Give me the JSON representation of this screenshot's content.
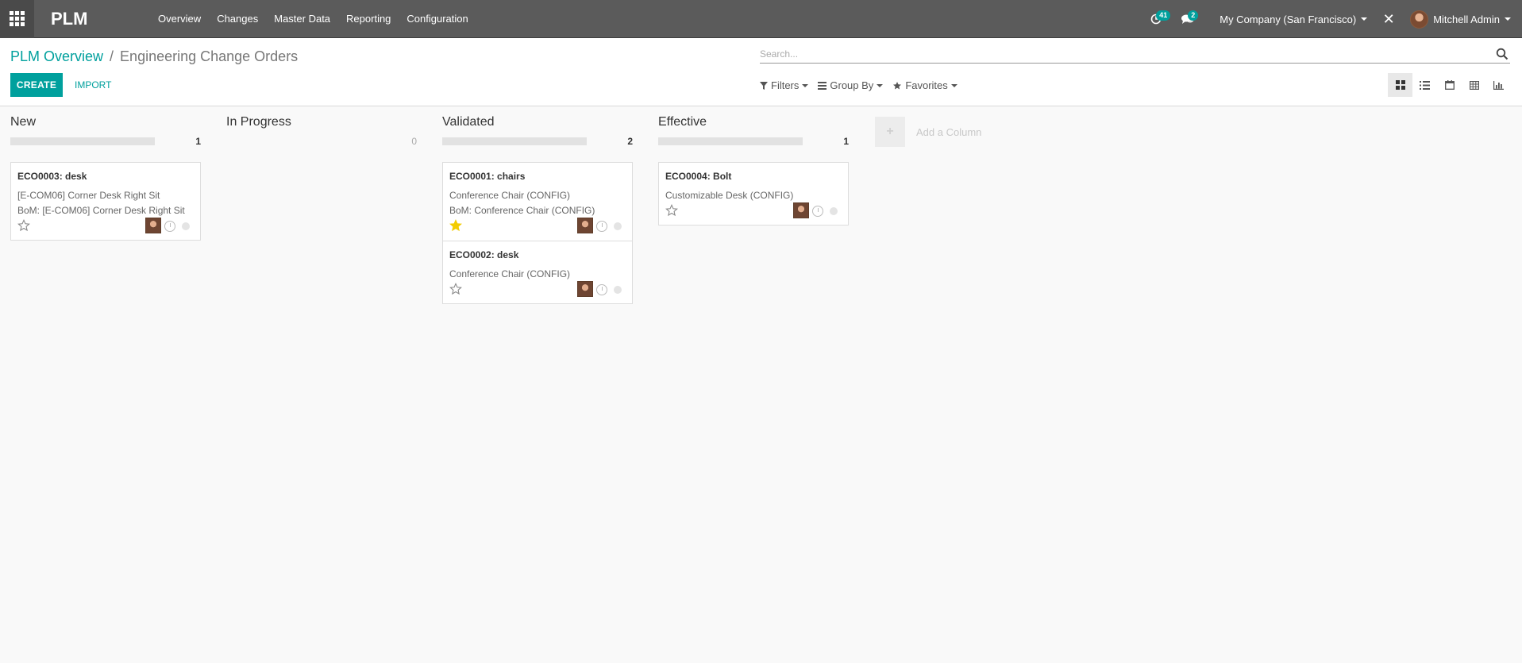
{
  "app": {
    "brand": "PLM"
  },
  "menu": [
    "Overview",
    "Changes",
    "Master Data",
    "Reporting",
    "Configuration"
  ],
  "systray": {
    "activity_count": "41",
    "messages_count": "2",
    "company": "My Company (San Francisco)",
    "user": "Mitchell Admin"
  },
  "breadcrumb": {
    "parent": "PLM Overview",
    "separator": "/",
    "current": "Engineering Change Orders"
  },
  "buttons": {
    "create": "CREATE",
    "import": "IMPORT"
  },
  "search": {
    "placeholder": "Search..."
  },
  "search_tools": {
    "filters": "Filters",
    "group_by": "Group By",
    "favorites": "Favorites"
  },
  "views": [
    "kanban-view",
    "list-view",
    "calendar-view",
    "pivot-view",
    "graph-view"
  ],
  "columns": [
    {
      "title": "New",
      "count": "1",
      "cards": [
        {
          "title": "ECO0003: desk",
          "lines": [
            "[E-COM06] Corner Desk Right Sit",
            "BoM: [E-COM06] Corner Desk Right Sit"
          ],
          "starred": false
        }
      ]
    },
    {
      "title": "In Progress",
      "count": "0",
      "cards": []
    },
    {
      "title": "Validated",
      "count": "2",
      "cards": [
        {
          "title": "ECO0001: chairs",
          "lines": [
            "Conference Chair (CONFIG)",
            "BoM: Conference Chair (CONFIG)"
          ],
          "starred": true
        },
        {
          "title": "ECO0002: desk",
          "lines": [
            "Conference Chair (CONFIG)"
          ],
          "starred": false
        }
      ]
    },
    {
      "title": "Effective",
      "count": "1",
      "cards": [
        {
          "title": "ECO0004: Bolt",
          "lines": [
            "Customizable Desk (CONFIG)"
          ],
          "starred": false
        }
      ]
    }
  ],
  "add_column": {
    "label": "Add a Column"
  },
  "colors": {
    "accent": "#00a09d",
    "navbar": "#5b5b5b",
    "star_active": "#f3cc00"
  }
}
